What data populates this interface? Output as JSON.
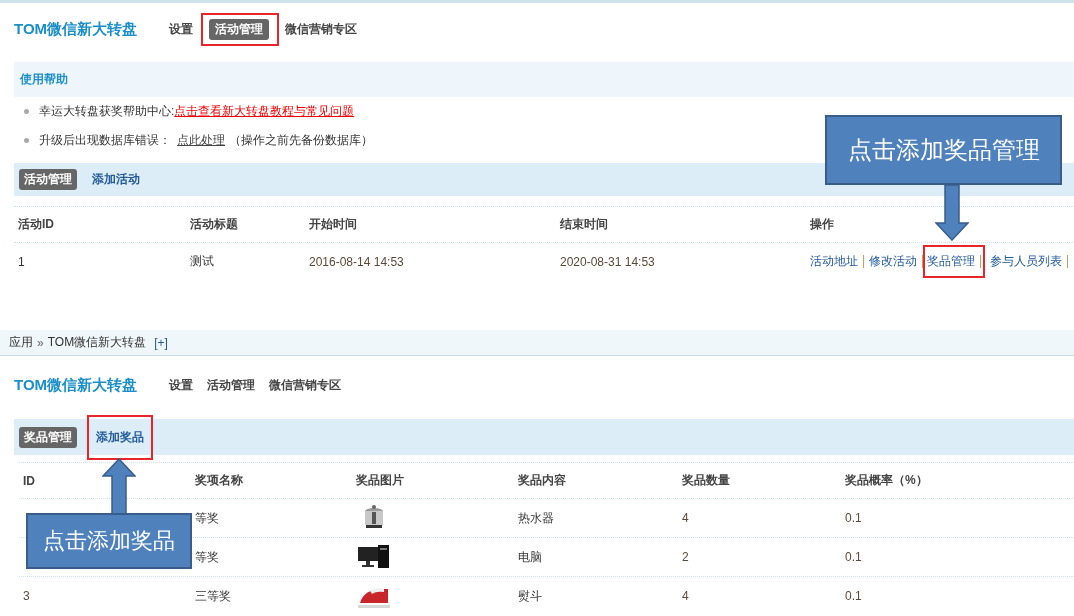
{
  "top": {
    "app_title": "TOM微信新大转盘",
    "nav": [
      {
        "label": "设置",
        "selected": false,
        "highlighted": false
      },
      {
        "label": "活动管理",
        "selected": true,
        "highlighted": true
      },
      {
        "label": "微信营销专区",
        "selected": false,
        "highlighted": false
      }
    ],
    "help": {
      "title": "使用帮助",
      "items": [
        {
          "text": "幸运大转盘获奖帮助中心:",
          "link": "点击查看新大转盘教程与常见问题",
          "kind": "alert"
        },
        {
          "text": "升级后出现数据库错误：",
          "link": "点此处理",
          "kind": "plain",
          "note": "（操作之前先备份数据库）"
        }
      ]
    },
    "subnav": [
      {
        "label": "活动管理",
        "selected": true,
        "highlighted": false
      },
      {
        "label": "添加活动",
        "selected": false,
        "highlighted": false
      }
    ],
    "table": {
      "columns": [
        "活动ID",
        "活动标题",
        "开始时间",
        "结束时间",
        "操作"
      ],
      "rows": [
        {
          "id": "1",
          "title": "测试",
          "start": "2016-08-14 14:53",
          "end": "2020-08-31 14:53",
          "actions": [
            {
              "label": "活动地址",
              "highlighted": false
            },
            {
              "label": "修改活动",
              "highlighted": false
            },
            {
              "label": "奖品管理",
              "highlighted": true
            },
            {
              "label": "参与人员列表",
              "highlighted": false
            }
          ]
        }
      ]
    }
  },
  "breadcrumb": {
    "items": [
      "应用",
      "TOM微信新大转盘"
    ],
    "separator": "»",
    "add": "[+]"
  },
  "bottom": {
    "app_title": "TOM微信新大转盘",
    "nav": [
      {
        "label": "设置",
        "selected": false,
        "highlighted": false
      },
      {
        "label": "活动管理",
        "selected": false,
        "highlighted": false
      },
      {
        "label": "微信营销专区",
        "selected": false,
        "highlighted": false
      }
    ],
    "subnav": [
      {
        "label": "奖品管理",
        "selected": true,
        "highlighted": false
      },
      {
        "label": "添加奖品",
        "selected": false,
        "highlighted": true
      }
    ],
    "table": {
      "columns": [
        "ID",
        "奖项名称",
        "奖品图片",
        "奖品内容",
        "奖品数量",
        "奖品概率（%）"
      ],
      "rows": [
        {
          "name": "等奖",
          "content": "热水器",
          "count": "4",
          "rate": "0.1"
        },
        {
          "name": "等奖",
          "content": "电脑",
          "count": "2",
          "rate": "0.1"
        },
        {
          "id": "3",
          "name": "三等奖",
          "content": "熨斗",
          "count": "4",
          "rate": "0.1"
        }
      ]
    }
  },
  "callouts": [
    {
      "text": "点击添加奖品管理"
    },
    {
      "text": "点击添加奖品"
    }
  ]
}
